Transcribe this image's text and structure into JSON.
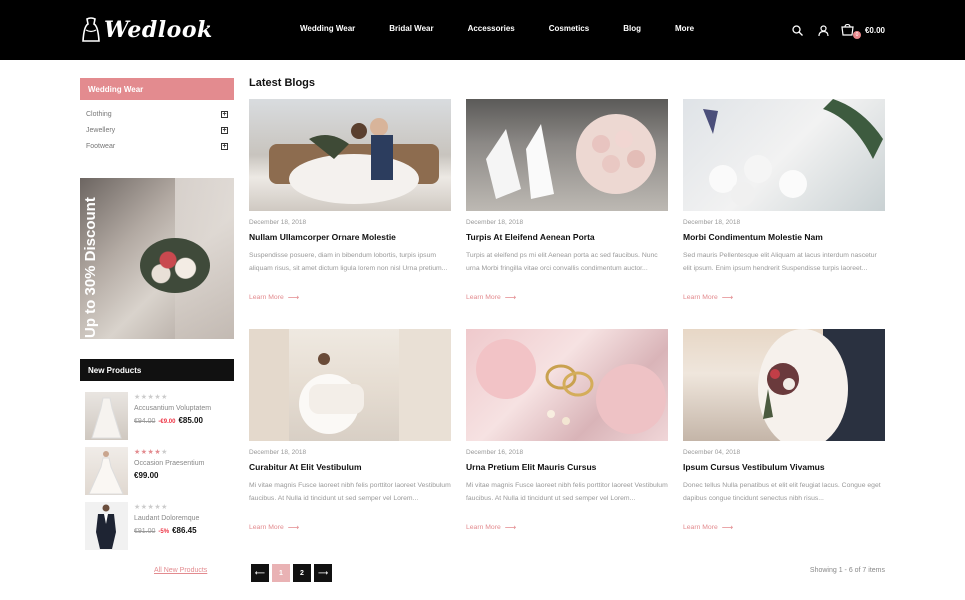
{
  "brand": {
    "name": "Wedlook"
  },
  "nav": [
    "Wedding Wear",
    "Bridal Wear",
    "Accessories",
    "Cosmetics",
    "Blog",
    "More"
  ],
  "header": {
    "cart_count": "0",
    "cart_total": "€0.00"
  },
  "sidebar": {
    "category_title": "Wedding Wear",
    "categories": [
      "Clothing",
      "Jewellery",
      "Footwear"
    ],
    "banner_text": "Up to 30% Discount",
    "new_products_title": "New Products",
    "products": [
      {
        "name": "Accusantium Voluptatem",
        "rating": 0,
        "old_price": "€94.00",
        "discount": "-€9.00",
        "price": "€85.00"
      },
      {
        "name": "Occasion Praesentium",
        "rating": 4,
        "old_price": "",
        "discount": "",
        "price": "€99.00"
      },
      {
        "name": "Laudant Doloremque",
        "rating": 0,
        "old_price": "€91.00",
        "discount": "-5%",
        "price": "€86.45"
      }
    ],
    "all_new_products": "All New Products"
  },
  "main": {
    "title": "Latest Blogs",
    "read_more": "Learn More",
    "posts": [
      {
        "date": "December 18, 2018",
        "title": "Nullam Ullamcorper Ornare Molestie",
        "text": "Suspendisse posuere, diam in bibendum lobortis, turpis ipsum aliquam risus, sit amet dictum ligula lorem non nisl Urna pretium..."
      },
      {
        "date": "December 18, 2018",
        "title": "Turpis At Eleifend Aenean Porta",
        "text": "Turpis at eleifend ps mi elit Aenean porta ac sed faucibus. Nunc urna Morbi fringilla vitae orci convallis condimentum auctor..."
      },
      {
        "date": "December 18, 2018",
        "title": "Morbi Condimentum Molestie Nam",
        "text": "Sed mauris Pellentesque elit Aliquam at lacus interdum nascetur elit ipsum. Enim ipsum hendrerit Suspendisse turpis laoreet..."
      },
      {
        "date": "December 18, 2018",
        "title": "Curabitur At Elit Vestibulum",
        "text": "Mi vitae magnis Fusce laoreet nibh felis porttitor laoreet Vestibulum faucibus. At Nulla id tincidunt ut sed semper vel Lorem..."
      },
      {
        "date": "December 16, 2018",
        "title": "Urna Pretium Elit Mauris Cursus",
        "text": "Mi vitae magnis Fusce laoreet nibh felis porttitor laoreet Vestibulum faucibus. At Nulla id tincidunt ut sed semper vel Lorem..."
      },
      {
        "date": "December 04, 2018",
        "title": "Ipsum Cursus Vestibulum Vivamus",
        "text": "Donec tellus Nulla penatibus et elit elit feugiat lacus. Congue eget dapibus congue tincidunt senectus nibh risus..."
      }
    ]
  },
  "pagination": {
    "prev": "⟵",
    "pages": [
      "1",
      "2"
    ],
    "next": "⟶",
    "active": "1",
    "showing": "Showing 1 - 6 of 7 items"
  },
  "colors": {
    "accent": "#e38b8f",
    "header_bg": "#000000"
  }
}
